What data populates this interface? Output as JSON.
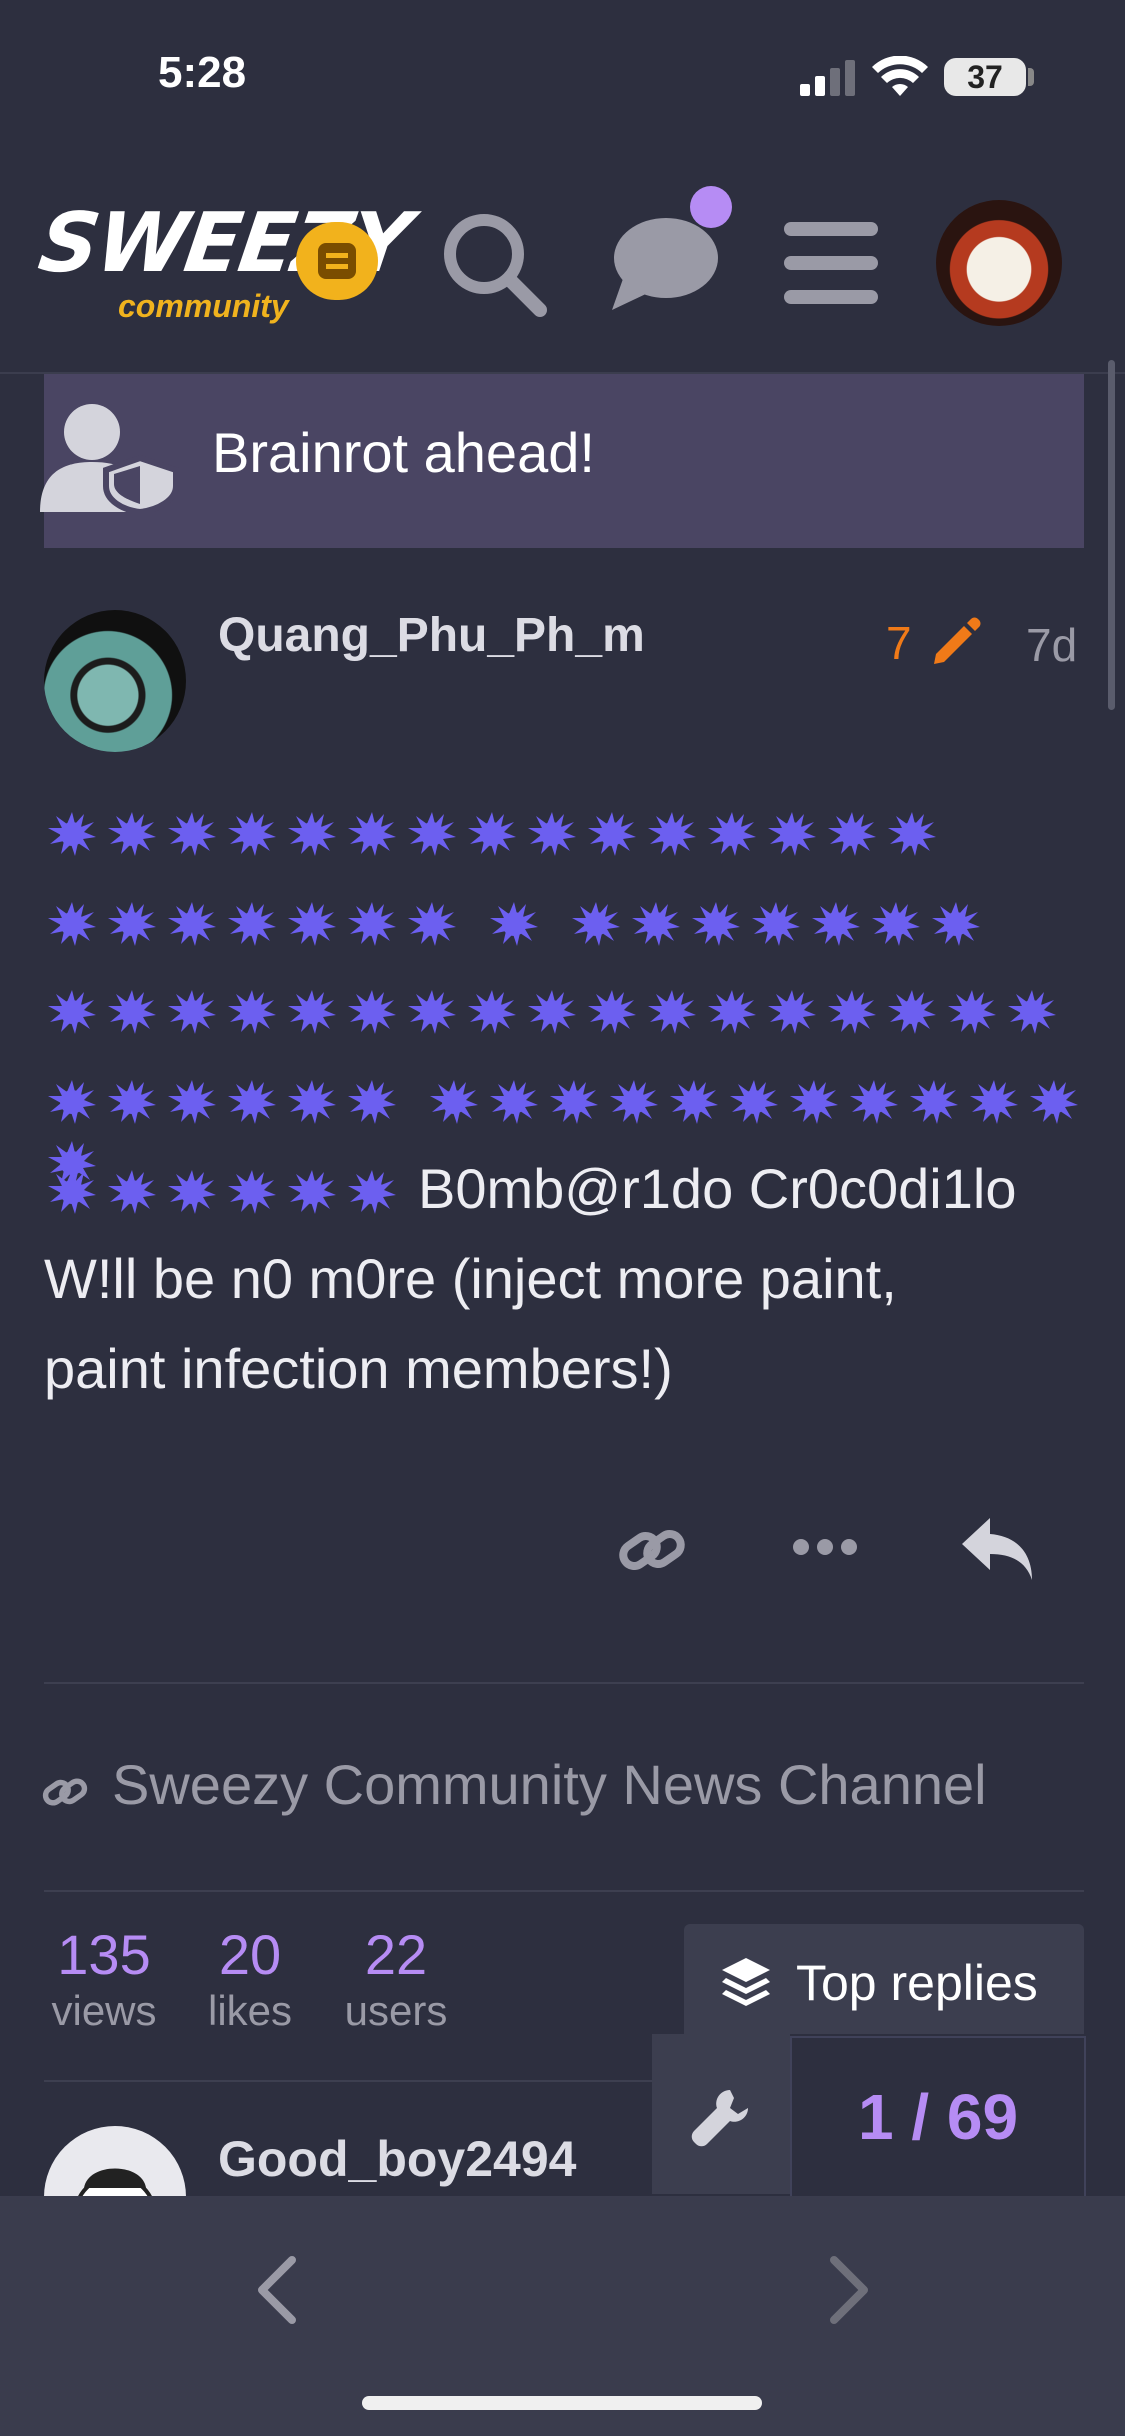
{
  "status_bar": {
    "time": "5:28",
    "battery": "37"
  },
  "header": {
    "logo_text": "SWEEZY",
    "logo_sub": "community",
    "icons": [
      "search-icon",
      "chat-icon",
      "hamburger-icon"
    ],
    "accent_color": "#b68cf4"
  },
  "banner": {
    "text": "Brainrot ahead!"
  },
  "post": {
    "username": "Quang_Phu_Ph_m",
    "edit_count": "7",
    "age": "7d",
    "splat_rows": [
      15,
      15,
      17,
      18,
      6
    ],
    "splat_color": "#6c5ff0",
    "lines": {
      "line1_tail": "B0mb@r1do Cr0c0di1lo",
      "line2": "W!ll be n0 m0re (inject more paint,",
      "line3": "paint infection members!)"
    }
  },
  "topic_link": {
    "text": "Sweezy Community News Channel"
  },
  "stats": [
    {
      "value": "135",
      "label": "views"
    },
    {
      "value": "20",
      "label": "likes"
    },
    {
      "value": "22",
      "label": "users"
    }
  ],
  "top_replies": {
    "label": "Top replies"
  },
  "progress": {
    "counter": "1 / 69"
  },
  "reply": {
    "username": "Good_boy2494"
  }
}
